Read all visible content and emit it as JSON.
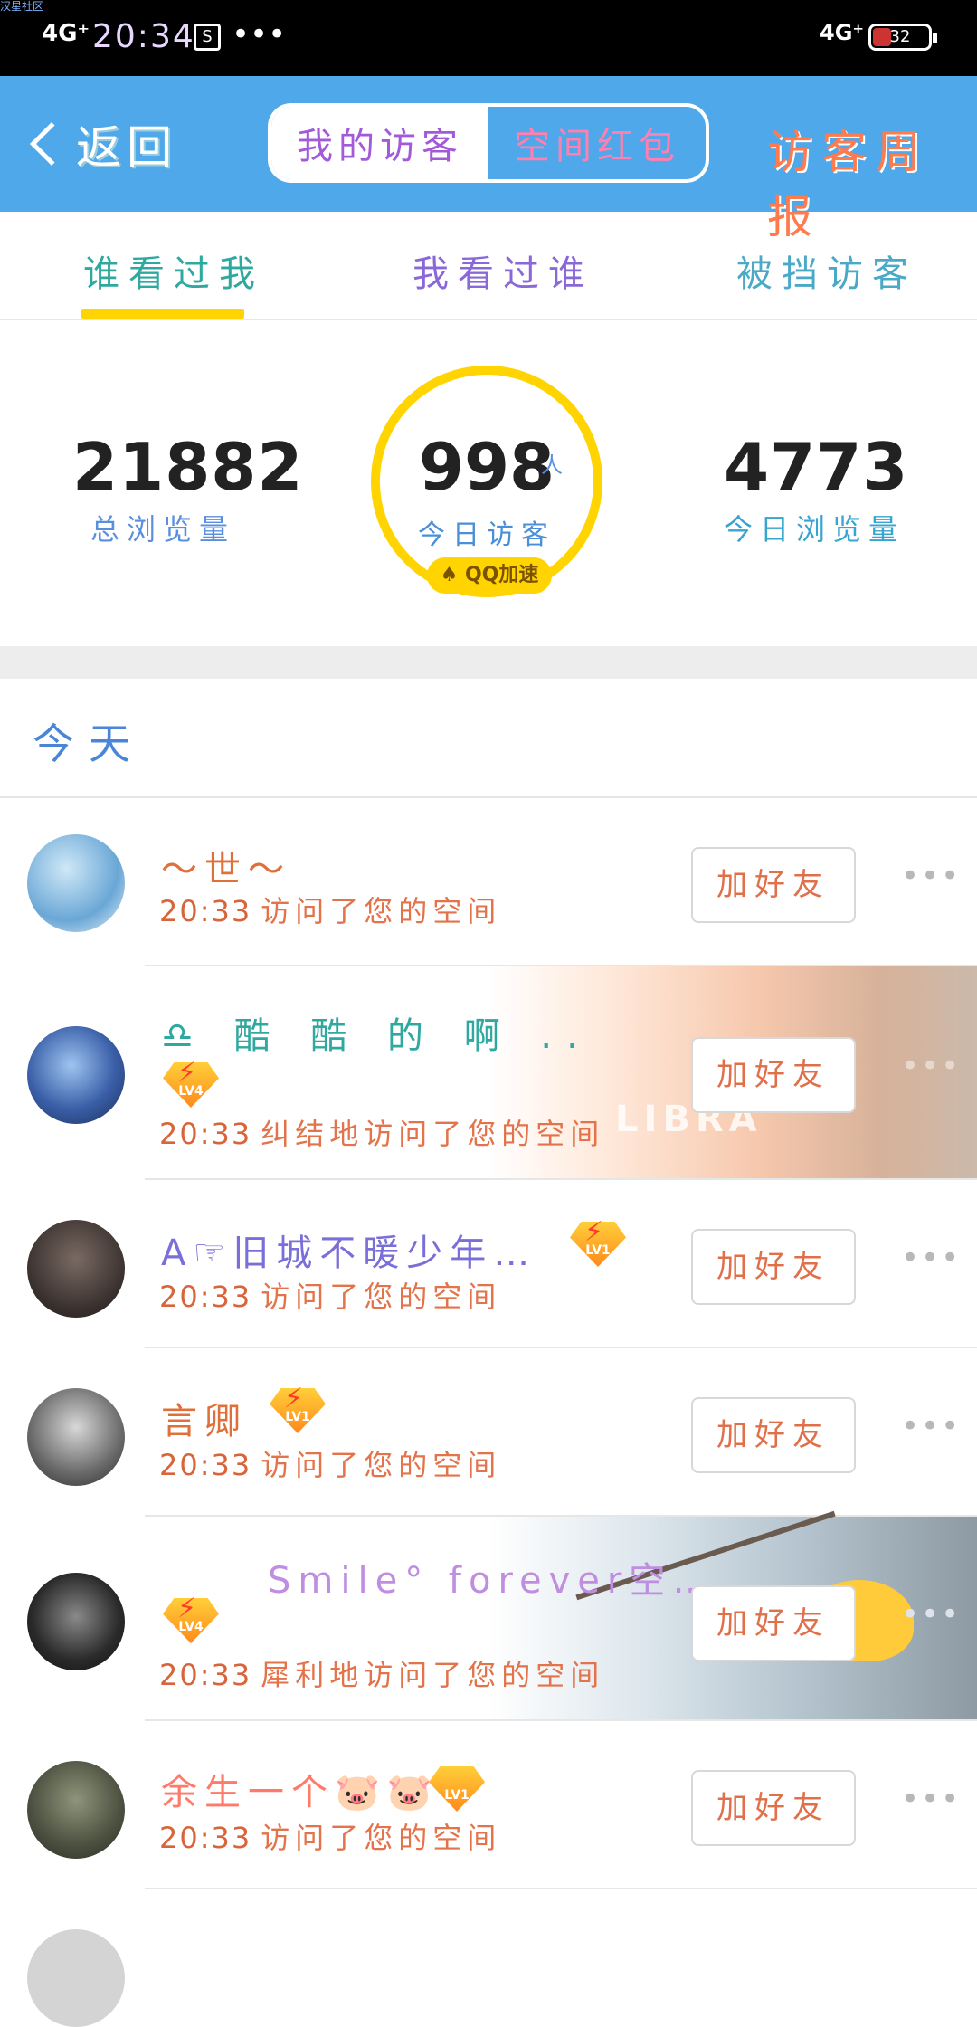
{
  "status_bar": {
    "watermark": "汉星社区",
    "network_left": "4G⁺",
    "time": "20:34",
    "sim_icon": "sim-icon",
    "more": "•••",
    "network_right": "4G⁺",
    "battery": "32"
  },
  "nav": {
    "back_label": "返回",
    "segments": [
      "我的访客",
      "空间红包"
    ],
    "active_segment": 0,
    "weekly_label": "访客周报",
    "bg_color": "#4ea8ea"
  },
  "tabs": [
    "谁看过我",
    "我看过谁",
    "被挡访客"
  ],
  "active_tab": 0,
  "stats": {
    "total_views": "21882",
    "total_views_label": "总浏览量",
    "today_visitors": "998",
    "today_visitors_unit": "人",
    "today_visitors_label": "今日访客",
    "qq_boost": "QQ加速",
    "today_views": "4773",
    "today_views_label": "今日浏览量"
  },
  "section_title": "今天",
  "add_friend_label": "加好友",
  "more_label": "•••",
  "visitors": [
    {
      "name": "～世～",
      "time": "20:33",
      "action": "访问了您的空间",
      "level": ""
    },
    {
      "name": "♎ 酷 酷 的 啊 ..",
      "time": "20:33",
      "action": "纠结地访问了您的空间",
      "level": "LV4",
      "banner_text": "LIBRA"
    },
    {
      "name": "A☞旧城不暖少年…",
      "time": "20:33",
      "action": "访问了您的空间",
      "level": "LV1"
    },
    {
      "name": "言卿",
      "time": "20:33",
      "action": "访问了您的空间",
      "level": "LV1"
    },
    {
      "name": "Smile° forever空…",
      "time": "20:33",
      "action": "犀利地访问了您的空间",
      "level": "LV4"
    },
    {
      "name": "余生一个🐷🐷",
      "time": "20:33",
      "action": "访问了您的空间",
      "level": "LV1"
    }
  ]
}
